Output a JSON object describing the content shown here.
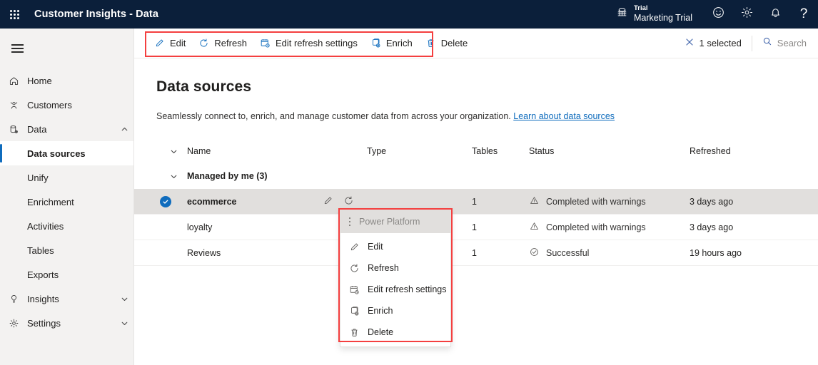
{
  "appbar": {
    "waffle_label": "app-launcher",
    "title": "Customer Insights - Data",
    "tenant_kicker": "Trial",
    "tenant_name": "Marketing Trial",
    "icons": [
      "globe-icon",
      "smiley-icon",
      "gear-icon",
      "bell-icon",
      "help-icon"
    ],
    "help_glyph": "?"
  },
  "sidebar": {
    "menu_toggle": "hamburger-menu",
    "items": [
      {
        "label": "Home",
        "icon": "home-icon",
        "level": 0,
        "chevron": "",
        "active": false
      },
      {
        "label": "Customers",
        "icon": "people-icon",
        "level": 0,
        "chevron": "",
        "active": false
      },
      {
        "label": "Data",
        "icon": "database-gear-icon",
        "level": 0,
        "chevron": "up",
        "active": false
      },
      {
        "label": "Data sources",
        "icon": "",
        "level": 1,
        "chevron": "",
        "active": true
      },
      {
        "label": "Unify",
        "icon": "",
        "level": 1,
        "chevron": "",
        "active": false
      },
      {
        "label": "Enrichment",
        "icon": "",
        "level": 1,
        "chevron": "",
        "active": false
      },
      {
        "label": "Activities",
        "icon": "",
        "level": 1,
        "chevron": "",
        "active": false
      },
      {
        "label": "Tables",
        "icon": "",
        "level": 1,
        "chevron": "",
        "active": false
      },
      {
        "label": "Exports",
        "icon": "",
        "level": 1,
        "chevron": "",
        "active": false
      },
      {
        "label": "Insights",
        "icon": "lightbulb-icon",
        "level": 0,
        "chevron": "down",
        "active": false
      },
      {
        "label": "Settings",
        "icon": "gear-icon",
        "level": 0,
        "chevron": "down",
        "active": false
      }
    ]
  },
  "commandbar": {
    "buttons": [
      {
        "label": "Edit",
        "icon": "pencil-icon"
      },
      {
        "label": "Refresh",
        "icon": "refresh-icon"
      },
      {
        "label": "Edit refresh settings",
        "icon": "calendar-clock-icon"
      },
      {
        "label": "Enrich",
        "icon": "enrich-icon"
      },
      {
        "label": "Delete",
        "icon": "trash-icon"
      }
    ],
    "selected_count_label": "1 selected",
    "search_placeholder": "Search"
  },
  "page": {
    "title": "Data sources",
    "subtitle_text": "Seamlessly connect to, enrich, and manage customer data from across your organization.",
    "subtitle_link": "Learn about data sources"
  },
  "table": {
    "columns": [
      "Name",
      "Type",
      "Tables",
      "Status",
      "Refreshed"
    ],
    "group_label": "Managed by me (3)",
    "rows": [
      {
        "name": "ecommerce",
        "type": "Power Platform",
        "tables": "1",
        "status": "Completed with warnings",
        "status_icon": "warning-icon",
        "refreshed": "3 days ago",
        "selected": true
      },
      {
        "name": "loyalty",
        "type": "",
        "tables": "1",
        "status": "Completed with warnings",
        "status_icon": "warning-icon",
        "refreshed": "3 days ago",
        "selected": false
      },
      {
        "name": "Reviews",
        "type": "",
        "tables": "1",
        "status": "Successful",
        "status_icon": "success-icon",
        "refreshed": "19 hours ago",
        "selected": false
      }
    ]
  },
  "context_menu": {
    "header_label": "Power Platform",
    "items": [
      {
        "label": "Edit",
        "icon": "pencil-icon"
      },
      {
        "label": "Refresh",
        "icon": "refresh-icon"
      },
      {
        "label": "Edit refresh settings",
        "icon": "calendar-clock-icon"
      },
      {
        "label": "Enrich",
        "icon": "enrich-icon"
      },
      {
        "label": "Delete",
        "icon": "trash-icon"
      }
    ]
  },
  "colors": {
    "appbar_bg": "#0b1f3a",
    "accent": "#0f6cbd",
    "sidebar_bg": "#f3f2f1",
    "selected_row_bg": "#e1dfdd",
    "annotation": "#f43f3f"
  }
}
